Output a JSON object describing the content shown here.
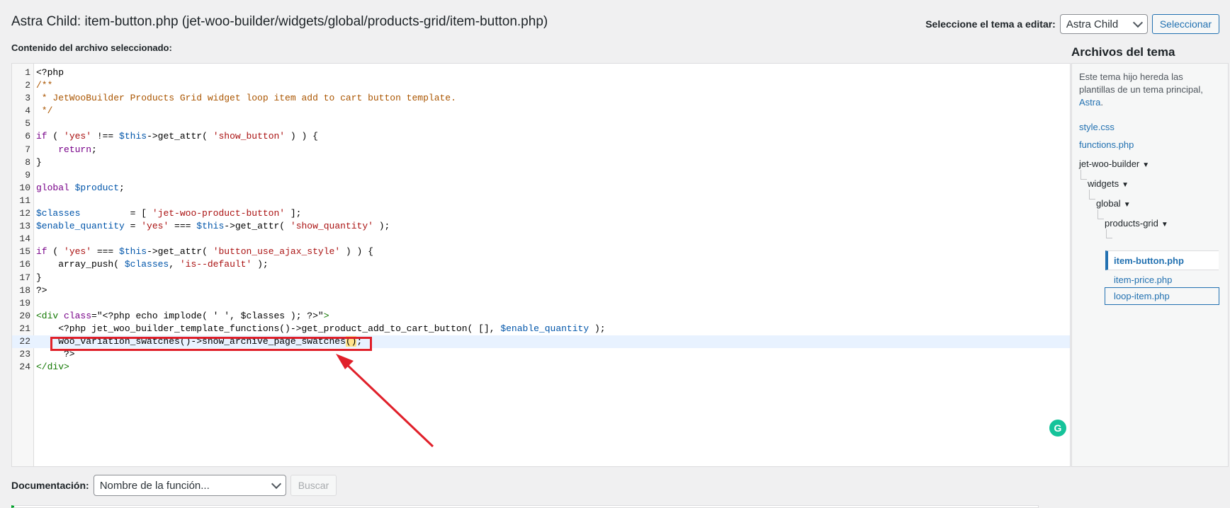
{
  "header": {
    "title": "Astra Child: item-button.php (jet-woo-builder/widgets/global/products-grid/item-button.php)",
    "theme_select_label": "Seleccione el tema a editar:",
    "theme_select_value": "Astra Child",
    "select_button": "Seleccionar"
  },
  "editor": {
    "content_label": "Contenido del archivo seleccionado:",
    "line_numbers": [
      "1",
      "2",
      "3",
      "4",
      "5",
      "6",
      "7",
      "8",
      "9",
      "10",
      "11",
      "12",
      "13",
      "14",
      "15",
      "16",
      "17",
      "18",
      "19",
      "20",
      "21",
      "22",
      "23",
      "24"
    ],
    "lines": {
      "l1": "<?php",
      "l2": "/**",
      "l3": " * JetWooBuilder Products Grid widget loop item add to cart button template.",
      "l4": " */",
      "l6a": "if",
      "l6b": " ( ",
      "l6c": "'yes'",
      "l6d": " !== ",
      "l6e": "$this",
      "l6f": "->get_attr( ",
      "l6g": "'show_button'",
      "l6h": " ) ) {",
      "l7a": "    ",
      "l7b": "return",
      "l7c": ";",
      "l8": "}",
      "l10a": "global",
      "l10b": " ",
      "l10c": "$product",
      "l10d": ";",
      "l12a": "$classes",
      "l12b": "         = [ ",
      "l12c": "'jet-woo-product-button'",
      "l12d": " ];",
      "l13a": "$enable_quantity",
      "l13b": " = ",
      "l13c": "'yes'",
      "l13d": " === ",
      "l13e": "$this",
      "l13f": "->get_attr( ",
      "l13g": "'show_quantity'",
      "l13h": " );",
      "l15a": "if",
      "l15b": " ( ",
      "l15c": "'yes'",
      "l15d": " === ",
      "l15e": "$this",
      "l15f": "->get_attr( ",
      "l15g": "'button_use_ajax_style'",
      "l15h": " ) ) {",
      "l16a": "    array_push( ",
      "l16b": "$classes",
      "l16c": ", ",
      "l16d": "'is--default'",
      "l16e": " );",
      "l17": "}",
      "l18": "?>",
      "l20a": "<div",
      "l20b": " class",
      "l20c": "=",
      "l20d": "\"<?php echo implode( ' ', $classes ); ?>\"",
      "l20e": ">",
      "l21a": "    <?php jet_woo_builder_template_functions()->get_product_add_to_cart_button( [], ",
      "l21b": "$enable_quantity",
      "l21c": " );",
      "l22a": "    woo_variation_swatches()->show_archive_page_swatches",
      "l22b": "()",
      "l22c": ";",
      "l23": "     ?>",
      "l24": "</div>"
    }
  },
  "files": {
    "title": "Archivos del tema",
    "desc_text": "Este tema hijo hereda las plantillas de un tema principal, ",
    "desc_link": "Astra",
    "desc_end": ".",
    "style": "style.css",
    "functions": "functions.php",
    "folder1": "jet-woo-builder",
    "folder2": "widgets",
    "folder3": "global",
    "folder4": "products-grid",
    "file_current": "item-button.php",
    "file_price": "item-price.php",
    "file_loop": "loop-item.php",
    "triangle": "▼"
  },
  "documentation": {
    "label": "Documentación:",
    "select_value": "Nombre de la función...",
    "search_button": "Buscar"
  },
  "colors": {
    "highlight_box": "#e0202a",
    "arrow": "#e0202a",
    "link": "#2271b1"
  },
  "icons": {
    "grammarly": "grammarly-icon",
    "grammarly_glyph": "G"
  }
}
